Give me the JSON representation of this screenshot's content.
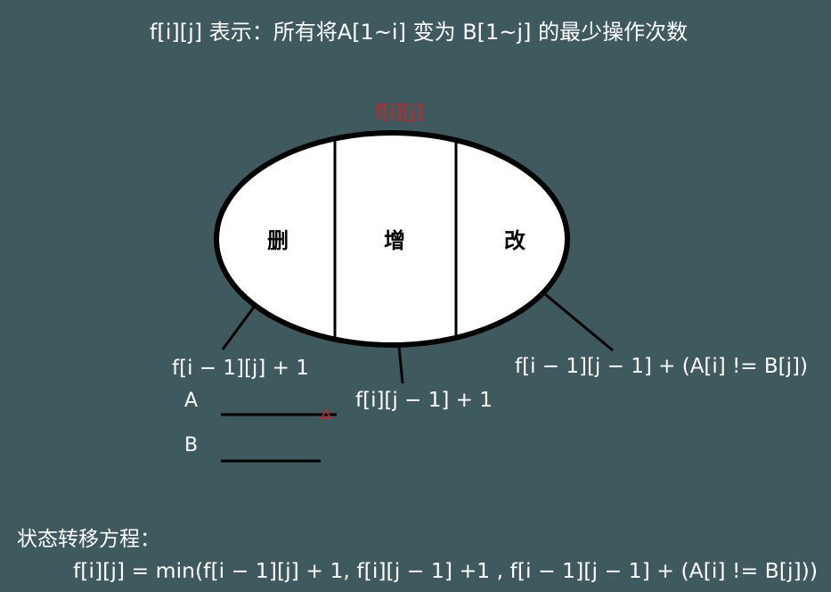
{
  "title": "f[i][j] 表示：所有将A[1~i] 变为 B[1~j] 的最少操作次数",
  "ellipse_label": "f[i][j]",
  "sections": {
    "delete": "删",
    "insert": "增",
    "replace": "改"
  },
  "branches": {
    "delete": "f[i − 1][j] + 1",
    "insert": "f[i][j − 1] + 1",
    "replace": "f[i − 1][j − 1] + (A[i] != B[j])"
  },
  "strings": {
    "a_label": "A",
    "b_label": "B"
  },
  "equation": {
    "label": "状态转移方程：",
    "formula": "f[i][j] = min(f[i − 1][j] + 1, f[i][j − 1] +1 , f[i − 1][j − 1] + (A[i] != B[j]))"
  },
  "colors": {
    "background": "#3f5a5f",
    "text": "#ffffff",
    "highlight": "#d42020",
    "ellipse_fill": "#ffffff",
    "stroke": "#000000"
  }
}
